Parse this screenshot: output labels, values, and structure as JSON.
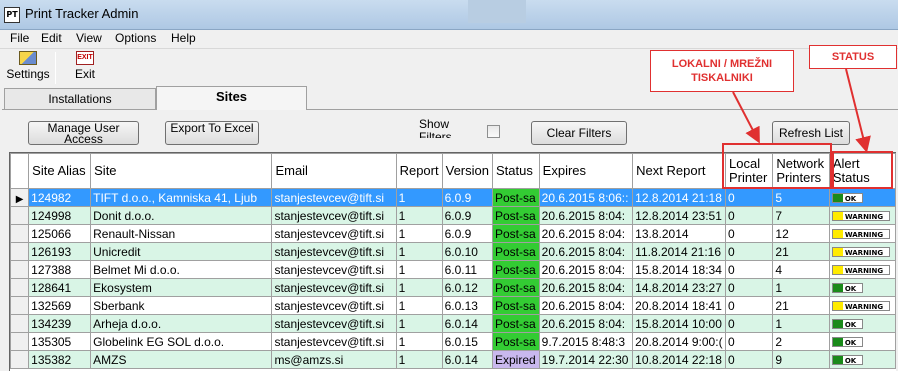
{
  "window": {
    "title": "Print Tracker Admin",
    "icon_text": "PT"
  },
  "menu": [
    "File",
    "Edit",
    "View",
    "Options",
    "Help"
  ],
  "toolbar": {
    "settings_label": "Settings",
    "settings_icon": "settings-icon",
    "exit_label": "Exit",
    "exit_icon_text": "EXIT"
  },
  "tabs": [
    {
      "label": "Installations",
      "active": false
    },
    {
      "label": "Sites",
      "active": true
    }
  ],
  "buttons": {
    "manage_user_access": "Manage User Access",
    "export_to_excel": "Export To Excel",
    "clear_filters": "Clear Filters",
    "refresh_list": "Refresh List"
  },
  "show_filters": {
    "label": "Show Filters",
    "checked": false
  },
  "annotations": {
    "printers": "LOKALNI / MREŽNI TISKALNIKI",
    "status": "STATUS"
  },
  "colors": {
    "selected_row": "#3399ff",
    "alt_row": "#d9f5e6",
    "status_post": "#33cc33",
    "status_expired": "#c9b8ee",
    "alert_ok": "#1a8a1a",
    "alert_warning": "#ffeb00",
    "annotation": "#e03030"
  },
  "grid": {
    "columns": [
      "Site Alias",
      "Site",
      "Email",
      "Report",
      "Version",
      "Status",
      "Expires",
      "Next Report",
      "Local Printer",
      "Network Printers",
      "Alert Status"
    ],
    "rows": [
      {
        "alias": "124982",
        "site": "TIFT d.o.o., Kamniska 41, Ljub",
        "email": "stanjestevcev@tift.si",
        "report": "1",
        "version": "6.0.9",
        "status": "Post-sa",
        "status_type": "post",
        "expires": "20.6.2015 8:06::",
        "next_report": "12.8.2014 21:18",
        "local": "0",
        "network": "5",
        "alert": "OK",
        "alert_type": "ok",
        "selected": true
      },
      {
        "alias": "124998",
        "site": "Donit d.o.o.",
        "email": "stanjestevcev@tift.si",
        "report": "1",
        "version": "6.0.9",
        "status": "Post-sa",
        "status_type": "post",
        "expires": "20.6.2015 8:04:",
        "next_report": "12.8.2014 23:51",
        "local": "0",
        "network": "7",
        "alert": "WARNING",
        "alert_type": "warn"
      },
      {
        "alias": "125066",
        "site": "Renault-Nissan",
        "email": "stanjestevcev@tift.si",
        "report": "1",
        "version": "6.0.9",
        "status": "Post-sa",
        "status_type": "post",
        "expires": "20.6.2015 8:04:",
        "next_report": "13.8.2014",
        "local": "0",
        "network": "12",
        "alert": "WARNING",
        "alert_type": "warn"
      },
      {
        "alias": "126193",
        "site": "Unicredit",
        "email": "stanjestevcev@tift.si",
        "report": "1",
        "version": "6.0.10",
        "status": "Post-sa",
        "status_type": "post",
        "expires": "20.6.2015 8:04:",
        "next_report": "11.8.2014 21:16",
        "local": "0",
        "network": "21",
        "alert": "WARNING",
        "alert_type": "warn"
      },
      {
        "alias": "127388",
        "site": "Belmet Mi d.o.o.",
        "email": "stanjestevcev@tift.si",
        "report": "1",
        "version": "6.0.11",
        "status": "Post-sa",
        "status_type": "post",
        "expires": "20.6.2015 8:04:",
        "next_report": "15.8.2014 18:34",
        "local": "0",
        "network": "4",
        "alert": "WARNING",
        "alert_type": "warn"
      },
      {
        "alias": "128641",
        "site": "Ekosystem",
        "email": "stanjestevcev@tift.si",
        "report": "1",
        "version": "6.0.12",
        "status": "Post-sa",
        "status_type": "post",
        "expires": "20.6.2015 8:04:",
        "next_report": "14.8.2014 23:27",
        "local": "0",
        "network": "1",
        "alert": "OK",
        "alert_type": "ok"
      },
      {
        "alias": "132569",
        "site": "Sberbank",
        "email": "stanjestevcev@tift.si",
        "report": "1",
        "version": "6.0.13",
        "status": "Post-sa",
        "status_type": "post",
        "expires": "20.6.2015 8:04:",
        "next_report": "20.8.2014 18:41",
        "local": "0",
        "network": "21",
        "alert": "WARNING",
        "alert_type": "warn"
      },
      {
        "alias": "134239",
        "site": "Arheja d.o.o.",
        "email": "stanjestevcev@tift.si",
        "report": "1",
        "version": "6.0.14",
        "status": "Post-sa",
        "status_type": "post",
        "expires": "20.6.2015 8:04:",
        "next_report": "15.8.2014 10:00",
        "local": "0",
        "network": "1",
        "alert": "OK",
        "alert_type": "ok"
      },
      {
        "alias": "135305",
        "site": "Globelink EG SOL d.o.o.",
        "email": "stanjestevcev@tift.si",
        "report": "1",
        "version": "6.0.15",
        "status": "Post-sa",
        "status_type": "post",
        "expires": "9.7.2015 8:48:3",
        "next_report": "20.8.2014 9:00:(",
        "local": "0",
        "network": "2",
        "alert": "OK",
        "alert_type": "ok"
      },
      {
        "alias": "135382",
        "site": "AMZS",
        "email": "ms@amzs.si",
        "report": "1",
        "version": "6.0.14",
        "status": "Expired",
        "status_type": "expired",
        "expires": "19.7.2014 22:30",
        "next_report": "10.8.2014 22:18",
        "local": "0",
        "network": "9",
        "alert": "OK",
        "alert_type": "ok"
      }
    ]
  }
}
